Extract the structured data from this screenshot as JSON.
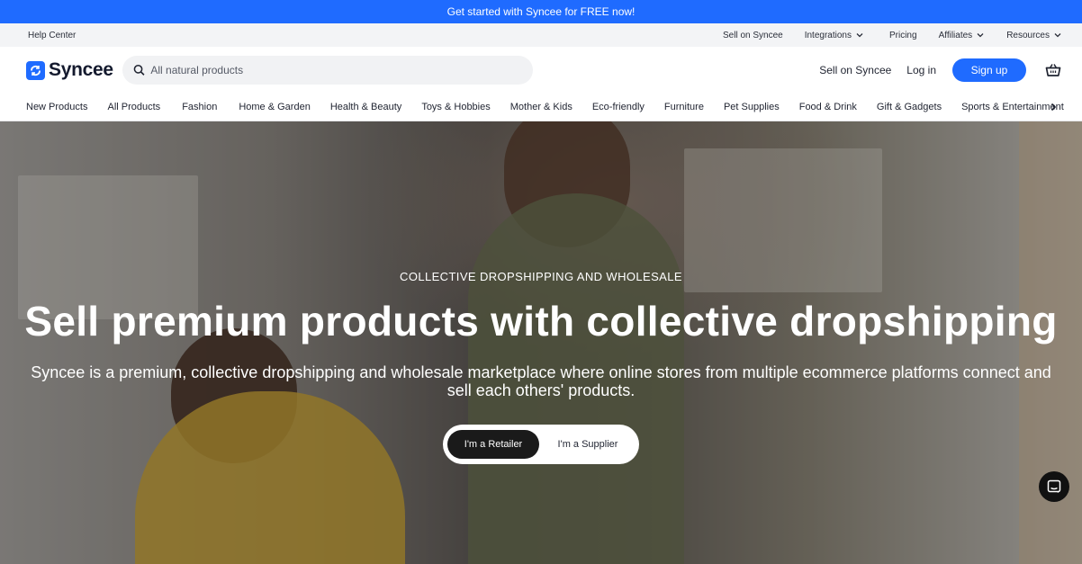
{
  "promo": {
    "text": "Get started with Syncee for FREE now!"
  },
  "utility": {
    "help_center": "Help Center",
    "links": [
      {
        "label": "Sell on Syncee",
        "dropdown": false
      },
      {
        "label": "Integrations",
        "dropdown": true
      },
      {
        "label": "Pricing",
        "dropdown": false
      },
      {
        "label": "Affiliates",
        "dropdown": true
      },
      {
        "label": "Resources",
        "dropdown": true
      }
    ]
  },
  "header": {
    "logo_text": "Syncee",
    "search_placeholder": "All natural products",
    "sell_link": "Sell on Syncee",
    "login": "Log in",
    "signup": "Sign up"
  },
  "categories": [
    "New Products",
    "All Products",
    "Fashion",
    "Home & Garden",
    "Health & Beauty",
    "Toys & Hobbies",
    "Mother & Kids",
    "Eco-friendly",
    "Furniture",
    "Pet Supplies",
    "Food & Drink",
    "Gift & Gadgets",
    "Sports & Entertainment"
  ],
  "hero": {
    "eyebrow": "COLLECTIVE DROPSHIPPING AND WHOLESALE",
    "headline": "Sell premium products with collective dropshipping",
    "subtitle": "Syncee is a premium, collective dropshipping and wholesale marketplace where online stores from multiple ecommerce platforms connect and sell each others' products.",
    "retailer": "I'm a Retailer",
    "supplier": "I'm a Supplier"
  },
  "colors": {
    "brand": "#1f6bff",
    "dark": "#1a1a1a"
  }
}
